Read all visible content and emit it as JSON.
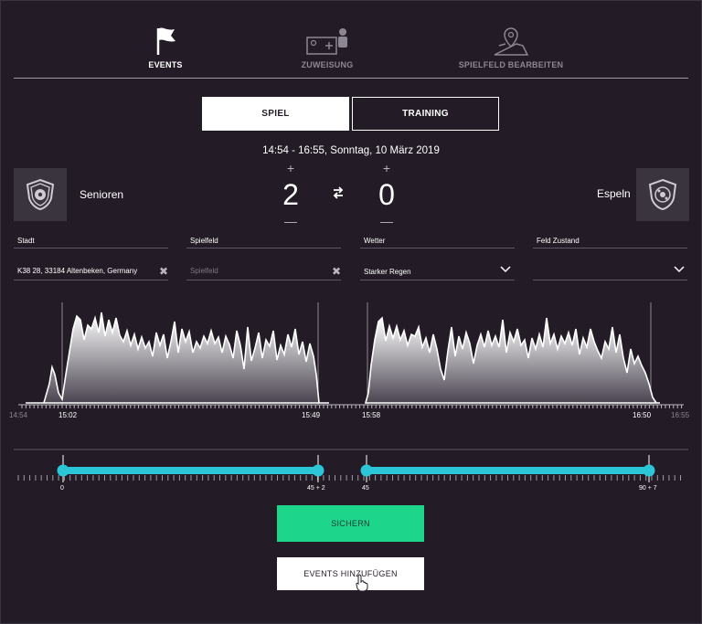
{
  "nav": {
    "items": [
      {
        "label": "EVENTS",
        "icon": "flag-icon",
        "active": true
      },
      {
        "label": "ZUWEISUNG",
        "icon": "assign-icon",
        "active": false
      },
      {
        "label": "SPIELFELD BEARBEITEN",
        "icon": "map-pin-icon",
        "active": false
      }
    ]
  },
  "mode": {
    "spiel": "SPIEL",
    "training": "TRAINING"
  },
  "match": {
    "datetime": "14:54 - 16:55, Sonntag, 10 März 2019",
    "home": {
      "name": "Senioren",
      "score": "2"
    },
    "away": {
      "name": "Espeln",
      "score": "0"
    },
    "plus": "+",
    "minus": "—"
  },
  "fields": {
    "stadt": {
      "label": "Stadt",
      "value": "K38 28, 33184 Altenbeken, Germany"
    },
    "spielfeld": {
      "label": "Spielfeld",
      "placeholder": "Spielfeld"
    },
    "wetter": {
      "label": "Wetter",
      "value": "Starker Regen"
    },
    "feld_zustand": {
      "label": "Feld Zustand",
      "value": ""
    }
  },
  "timeline": {
    "labels": {
      "start": "14:54",
      "half1_start": "15:02",
      "half1_end": "15:49",
      "half2_start": "15:58",
      "half2_end": "16:50",
      "end": "16:55"
    }
  },
  "slider": {
    "labels": {
      "h1_start": "0",
      "h1_end": "45 + 2",
      "h2_start": "45",
      "h2_end": "90 + 7"
    },
    "accent": "#2bc6d8",
    "h1_range_minutes": [
      0,
      47
    ],
    "h2_range_minutes": [
      45,
      97
    ]
  },
  "buttons": {
    "save": "SICHERN",
    "add_events": "EVENTS HINZUFÜGEN"
  },
  "colors": {
    "background": "#231c26",
    "save": "#1ed58c",
    "accent": "#2bc6d8"
  }
}
